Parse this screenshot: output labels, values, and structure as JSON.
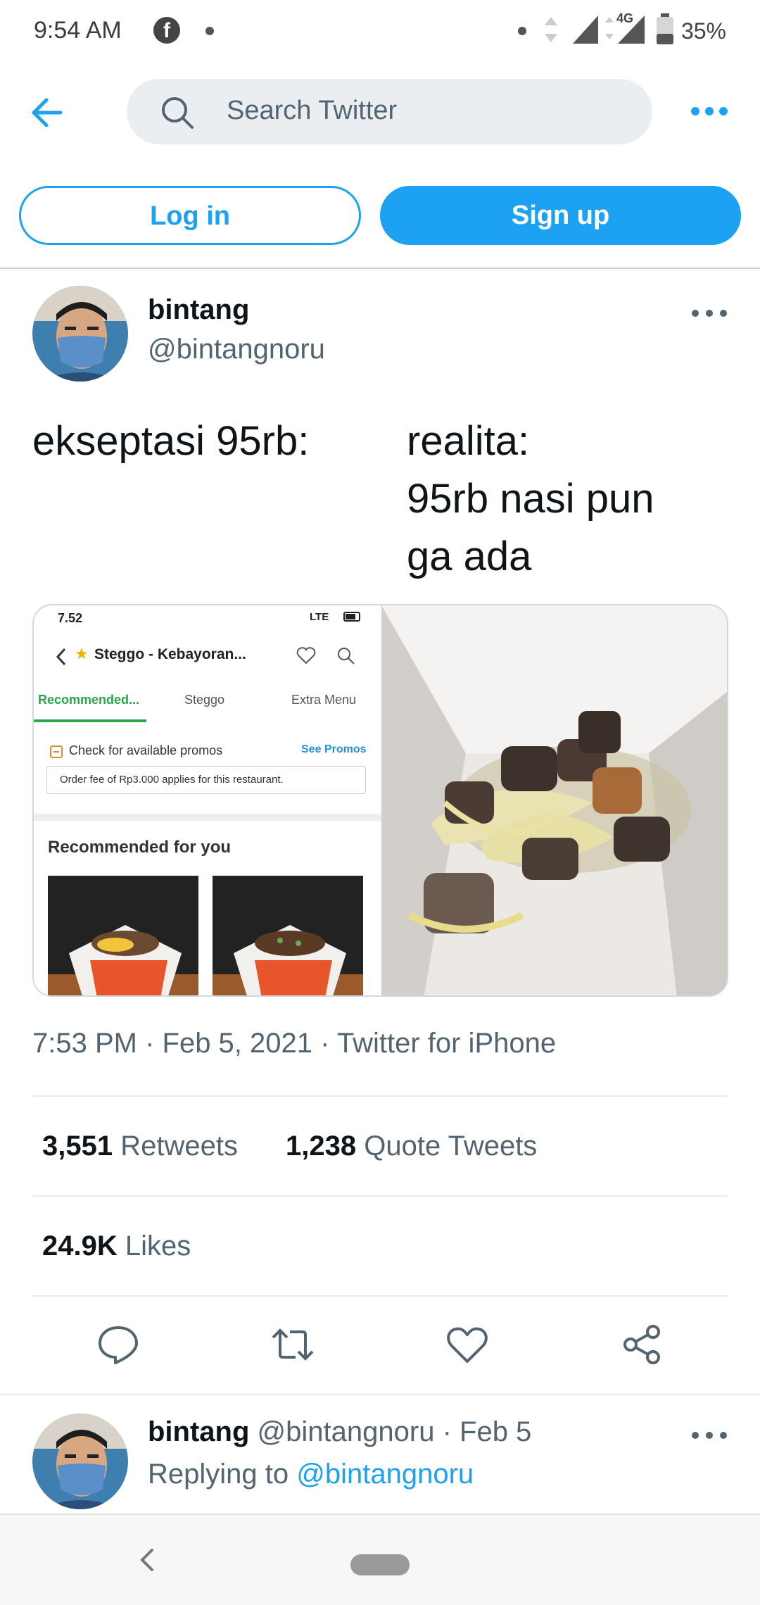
{
  "status_bar": {
    "time": "9:54 AM",
    "network": "4G",
    "battery": "35%"
  },
  "search": {
    "placeholder": "Search Twitter"
  },
  "auth": {
    "login_label": "Log in",
    "signup_label": "Sign up"
  },
  "tweet": {
    "author_name": "bintang",
    "author_handle": "@bintangnoru",
    "text_left": "ekseptasi 95rb:",
    "text_right": "realita:\n95rb nasi pun\nga ada",
    "timestamp": "7:53 PM · Feb 5, 2021",
    "source": "Twitter for iPhone",
    "retweets_count": "3,551",
    "retweets_label": "Retweets",
    "quotes_count": "1,238",
    "quotes_label": "Quote Tweets",
    "likes_count": "24.9K",
    "likes_label": "Likes"
  },
  "media": {
    "screenshot": {
      "time": "7.52",
      "signal_label": "LTE",
      "restaurant_title": "Steggo - Kebayoran...",
      "tabs": [
        "Recommended...",
        "Steggo",
        "Extra Menu"
      ],
      "promo_text": "Check for available promos",
      "promo_link": "See Promos",
      "fee_text": "Order fee of Rp3.000 applies for this restaurant.",
      "section_title": "Recommended for you"
    }
  },
  "reply": {
    "author_name": "bintang",
    "author_handle": "@bintangnoru",
    "date": "Feb 5",
    "replying_prefix": "Replying to",
    "replying_to": "@bintangnoru"
  },
  "colors": {
    "accent": "#1da1f2",
    "text_primary": "#0f1419",
    "text_secondary": "#536471"
  }
}
